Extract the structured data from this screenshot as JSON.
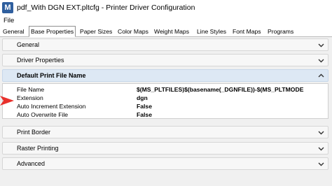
{
  "window": {
    "title": "pdf_With DGN EXT.pltcfg - Printer Driver Configuration",
    "icon": "app-logo-icon"
  },
  "menu": {
    "file": "File"
  },
  "tabs": [
    {
      "label": "General",
      "active": false
    },
    {
      "label": "Base Properties",
      "active": true
    },
    {
      "label": "Paper Sizes",
      "active": false
    },
    {
      "label": "Color Maps",
      "active": false
    },
    {
      "label": "Weight Maps",
      "active": false
    },
    {
      "label": "Line Styles",
      "active": false
    },
    {
      "label": "Font Maps",
      "active": false
    },
    {
      "label": "Programs",
      "active": false
    }
  ],
  "sections": {
    "general": "General",
    "driver_properties": "Driver Properties",
    "default_print_file_name": "Default Print File Name",
    "print_border": "Print Border",
    "raster_printing": "Raster Printing",
    "advanced": "Advanced"
  },
  "properties": [
    {
      "name": "File Name",
      "value": "$(MS_PLTFILES)$(basename(_DGNFILE))-$(MS_PLTMODE"
    },
    {
      "name": "Extension",
      "value": "dgn"
    },
    {
      "name": "Auto Increment Extension",
      "value": "False"
    },
    {
      "name": "Auto Overwrite File",
      "value": "False"
    }
  ],
  "colors": {
    "accent": "#2f5f9e",
    "expanded_header": "#dde8f4",
    "arrow": "#e8302b"
  }
}
